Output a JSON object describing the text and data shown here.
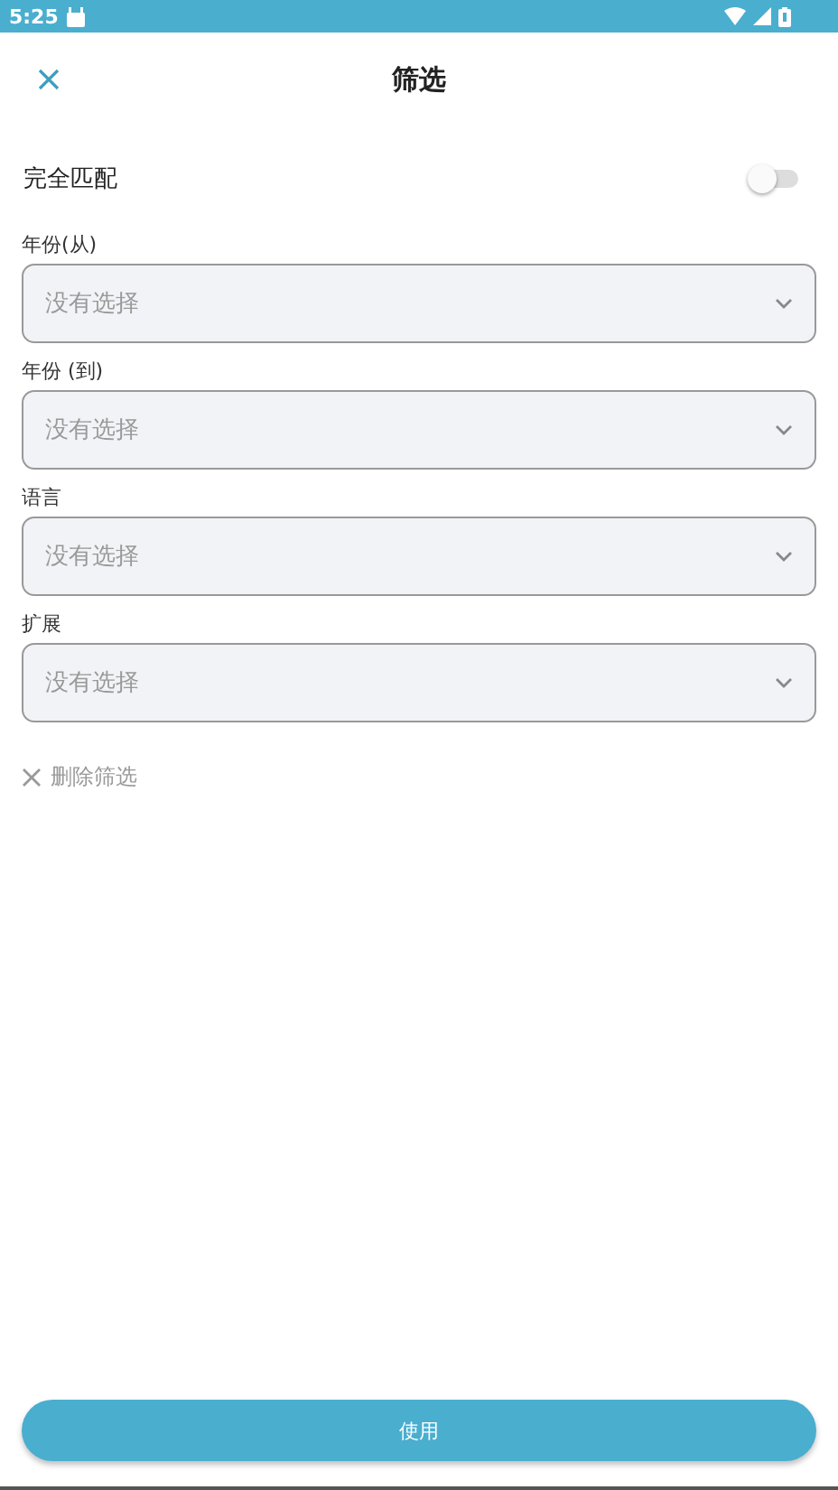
{
  "status_bar": {
    "time": "5:25"
  },
  "header": {
    "title": "筛选"
  },
  "exact_match": {
    "label": "完全匹配",
    "on": false
  },
  "fields": [
    {
      "label": "年份(从)",
      "placeholder": "没有选择"
    },
    {
      "label": "年份 (到)",
      "placeholder": "没有选择"
    },
    {
      "label": "语言",
      "placeholder": "没有选择"
    },
    {
      "label": "扩展",
      "placeholder": "没有选择"
    }
  ],
  "clear_link": "删除筛选",
  "apply_button": "使用"
}
